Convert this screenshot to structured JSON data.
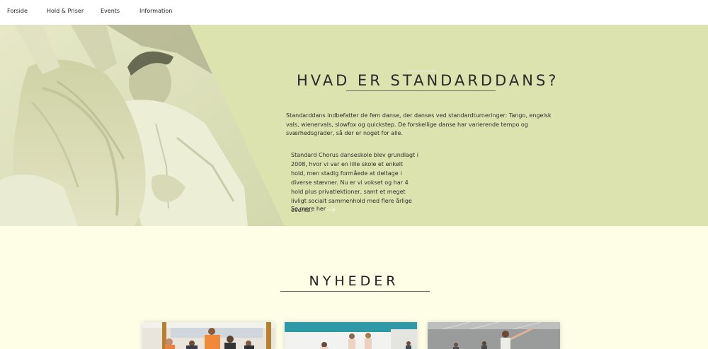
{
  "nav": {
    "items": [
      {
        "label": "Forside"
      },
      {
        "label": "Hold & Priser"
      },
      {
        "label": "Events"
      },
      {
        "label": "Information"
      }
    ]
  },
  "hero": {
    "title": "HVAD ER STANDARDDANS?",
    "paragraph1": "Standarddans indbefatter de fem danse, der danses ved standardturneringer: Tango, engelsk vals, wienervals, slowfox og quickstep. De forskellige danse har varierende tempo og sværhedsgrader, så der er noget for alle.",
    "paragraph2": "Standard Chorus danseskole blev grundlagt i 2008, hvor vi var en lille skole et enkelt hold, men stadig formåede at deltage i diverse stævner. Nu er vi vokset og har 4 hold plus privatlektioner, samt et meget livligt socialt sammenhold med flere årlige events.",
    "see_more": "Se mere her",
    "photo_icon": "dancing-couple-photo",
    "arrow_icon": "arrow-right-icon"
  },
  "news": {
    "title": "NYHEDER",
    "cards": [
      {
        "image": "group-dance-class-photo"
      },
      {
        "image": "dance-studio-photo"
      },
      {
        "image": "dancers-studio-photo"
      }
    ]
  },
  "colors": {
    "hero_bg": "#dde3ae",
    "page_bg": "#fefee7",
    "nav_bg": "#ffffff",
    "text": "#2b2b2b"
  }
}
